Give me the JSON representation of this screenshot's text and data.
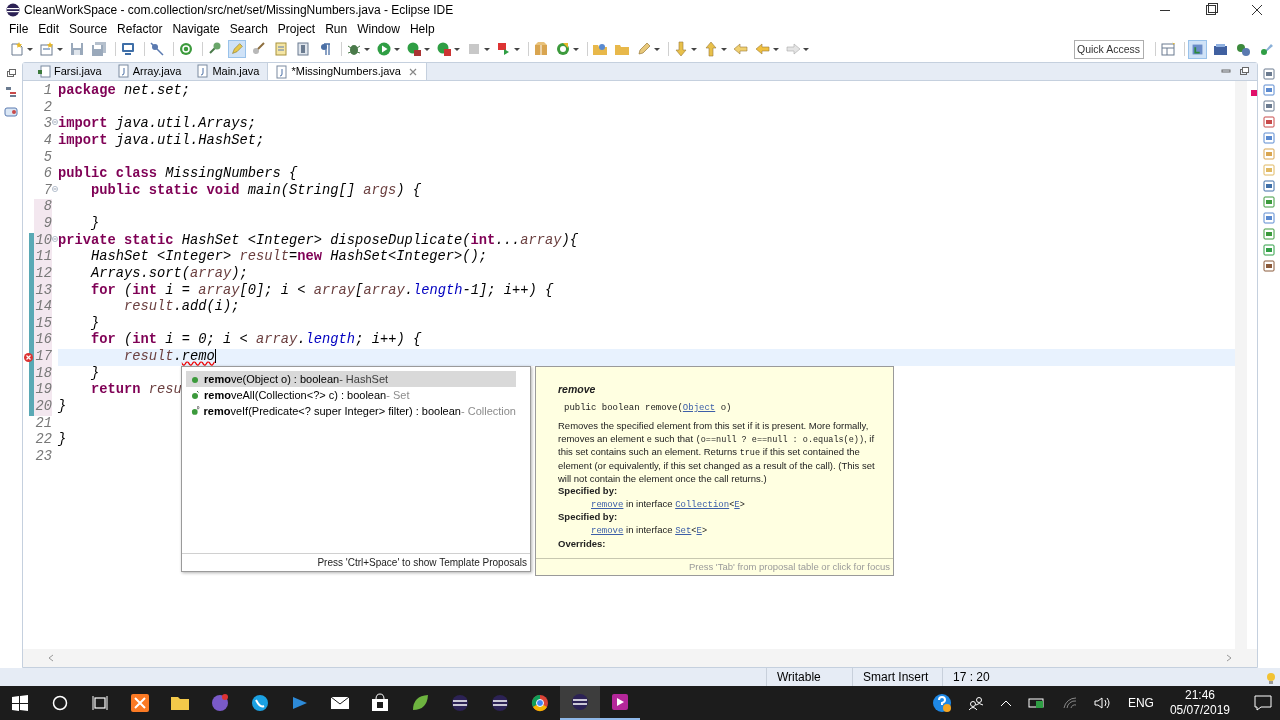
{
  "window": {
    "title": "CleanWorkSpace - com.collection/src/net/set/MissingNumbers.java - Eclipse IDE"
  },
  "menu": [
    "File",
    "Edit",
    "Source",
    "Refactor",
    "Navigate",
    "Search",
    "Project",
    "Run",
    "Window",
    "Help"
  ],
  "toolbar": {
    "mark_occurrences_pressed": true,
    "quick_access": {
      "placeholder": "Quick Access"
    }
  },
  "perspectives": [
    {
      "selected": true
    },
    {
      "selected": false
    },
    {
      "selected": false
    },
    {
      "selected": false
    }
  ],
  "tabs": [
    {
      "label": "Farsi.java",
      "kind": "main",
      "selected": false
    },
    {
      "label": "Array.java",
      "kind": "class",
      "selected": false
    },
    {
      "label": "Main.java",
      "kind": "class",
      "selected": false
    },
    {
      "label": "*MissingNumbers.java",
      "kind": "class",
      "selected": true
    }
  ],
  "editor": {
    "lines": [
      {
        "number": "1",
        "current": false,
        "tokens": [
          {
            "kind": "keyword",
            "text": "package"
          },
          {
            "kind": "text",
            "text": " net.set;"
          }
        ]
      },
      {
        "number": "2",
        "current": false
      },
      {
        "number": "3",
        "current": false,
        "expanded": true,
        "tokens": [
          {
            "kind": "keyword",
            "text": "import"
          },
          {
            "kind": "text",
            "text": " java.util.Arrays;"
          }
        ]
      },
      {
        "number": "4",
        "current": false,
        "tokens": [
          {
            "kind": "keyword",
            "text": "import"
          },
          {
            "kind": "text",
            "text": " java.util.HashSet;"
          }
        ]
      },
      {
        "number": "5",
        "current": false
      },
      {
        "number": "6",
        "current": false,
        "tokens": [
          {
            "kind": "keyword",
            "text": "public class"
          },
          {
            "kind": "text",
            "text": " MissingNumbers {"
          }
        ]
      },
      {
        "number": "7",
        "current": false,
        "expanded": true,
        "tokens": [
          {
            "kind": "keyword",
            "text": "    public static void"
          },
          {
            "kind": "text",
            "text": " main(String[] "
          },
          {
            "kind": "variable",
            "text": "args"
          },
          {
            "kind": "text",
            "text": ") {"
          }
        ]
      },
      {
        "number": "8",
        "current": false,
        "changed": true
      },
      {
        "number": "9",
        "current": false,
        "changed": true,
        "tokens": [
          {
            "kind": "text",
            "text": "    }"
          }
        ]
      },
      {
        "number": "10",
        "current": false,
        "added": true,
        "expanded": true,
        "tokens": [
          {
            "kind": "keyword",
            "text": "private static"
          },
          {
            "kind": "text",
            "text": " HashSet <Integer> disposeDuplicate("
          },
          {
            "kind": "keyword",
            "text": "int"
          },
          {
            "kind": "text",
            "text": "..."
          },
          {
            "kind": "variable",
            "text": "array"
          },
          {
            "kind": "text",
            "text": "){"
          }
        ]
      },
      {
        "number": "11",
        "current": false,
        "added": true,
        "tokens": [
          {
            "kind": "text",
            "text": "    HashSet <Integer> "
          },
          {
            "kind": "variable",
            "text": "result"
          },
          {
            "kind": "text",
            "text": "="
          },
          {
            "kind": "keyword",
            "text": "new"
          },
          {
            "kind": "text",
            "text": " HashSet<Integer>();"
          }
        ]
      },
      {
        "number": "12",
        "current": false,
        "added": true,
        "tokens": [
          {
            "kind": "text",
            "text": "    Arrays.sort("
          },
          {
            "kind": "variable",
            "text": "array"
          },
          {
            "kind": "text",
            "text": ");"
          }
        ]
      },
      {
        "number": "13",
        "current": false,
        "added": true,
        "tokens": [
          {
            "kind": "keyword",
            "text": "    for"
          },
          {
            "kind": "text",
            "text": " ("
          },
          {
            "kind": "keyword",
            "text": "int"
          },
          {
            "kind": "text",
            "text": " i = "
          },
          {
            "kind": "variable",
            "text": "array"
          },
          {
            "kind": "text",
            "text": "[0]; i < "
          },
          {
            "kind": "variable",
            "text": "array"
          },
          {
            "kind": "text",
            "text": "["
          },
          {
            "kind": "variable",
            "text": "array"
          },
          {
            "kind": "text",
            "text": "."
          },
          {
            "kind": "field",
            "text": "length"
          },
          {
            "kind": "text",
            "text": "-1]; i++) {"
          }
        ]
      },
      {
        "number": "14",
        "current": false,
        "added": true,
        "tokens": [
          {
            "kind": "variable",
            "text": "        result"
          },
          {
            "kind": "text",
            "text": ".add(i);"
          }
        ]
      },
      {
        "number": "15",
        "current": false,
        "added": true,
        "tokens": [
          {
            "kind": "text",
            "text": "    }"
          }
        ]
      },
      {
        "number": "16",
        "current": false,
        "added": true,
        "tokens": [
          {
            "kind": "keyword",
            "text": "    for"
          },
          {
            "kind": "text",
            "text": " ("
          },
          {
            "kind": "keyword",
            "text": "int"
          },
          {
            "kind": "text",
            "text": " i = 0; i < "
          },
          {
            "kind": "variable",
            "text": "array"
          },
          {
            "kind": "text",
            "text": "."
          },
          {
            "kind": "field",
            "text": "length"
          },
          {
            "kind": "text",
            "text": "; i++) {"
          }
        ]
      },
      {
        "number": "17",
        "current": true,
        "added": true,
        "error": true,
        "tokens": [
          {
            "kind": "variable",
            "text": "        result"
          },
          {
            "kind": "text",
            "text": "."
          },
          {
            "kind": "error",
            "text": "remo"
          }
        ]
      },
      {
        "number": "18",
        "current": false,
        "added": true,
        "tokens": [
          {
            "kind": "text",
            "text": "    }"
          }
        ]
      },
      {
        "number": "19",
        "current": false,
        "added": true,
        "tokens": [
          {
            "kind": "keyword",
            "text": "    return"
          },
          {
            "kind": "variable",
            "text": " resu"
          }
        ]
      },
      {
        "number": "20",
        "current": false,
        "added": true,
        "tokens": [
          {
            "kind": "text",
            "text": "}"
          }
        ]
      },
      {
        "number": "21",
        "current": false
      },
      {
        "number": "22",
        "current": false,
        "tokens": [
          {
            "kind": "text",
            "text": "}"
          }
        ]
      },
      {
        "number": "23",
        "current": false
      }
    ]
  },
  "proposals": {
    "items": [
      {
        "label": "**remo**ve(Object o) : boolean",
        "owner": " - HashSet",
        "kind": "method",
        "selected": true
      },
      {
        "label": "**remo**veAll(Collection<?> c) : boolean",
        "owner": " - Set",
        "kind": "abstract",
        "selected": false
      },
      {
        "label": "**remo**veIf(Predicate<? super Integer> filter) : boolean",
        "owner": " - Collection",
        "kind": "default",
        "selected": false
      }
    ],
    "footer": "Press 'Ctrl+Space' to show Template Proposals"
  },
  "javadoc": {
    "title": "remove",
    "signature": [
      {
        "kind": "code",
        "text": "public boolean remove("
      },
      {
        "kind": "link",
        "text": "Object"
      },
      {
        "kind": "code",
        "text": " o)"
      }
    ],
    "description": [
      {
        "kind": "text",
        "text": "Removes the specified element from this set if it is present. More formally, removes an element "
      },
      {
        "kind": "code",
        "text": "e"
      },
      {
        "kind": "text",
        "text": " such that "
      },
      {
        "kind": "code",
        "text": "(o==null ? e==null : o.equals(e))"
      },
      {
        "kind": "text",
        "text": ", if this set contains such an element. Returns "
      },
      {
        "kind": "code",
        "text": "true"
      },
      {
        "kind": "text",
        "text": " if this set contained the element (or equivalently, if this set changed as a result of the call). (This set will not contain the element once the call returns.)"
      }
    ],
    "sections": [
      {
        "heading": "Specified by:",
        "entry": [
          {
            "kind": "link",
            "text": "remove"
          },
          {
            "kind": "text",
            "text": " in interface "
          },
          {
            "kind": "link",
            "text": "Collection"
          },
          {
            "kind": "code",
            "text": "<"
          },
          {
            "kind": "link",
            "text": "E"
          },
          {
            "kind": "code",
            "text": ">"
          }
        ]
      },
      {
        "heading": "Specified by:",
        "entry": [
          {
            "kind": "link",
            "text": "remove"
          },
          {
            "kind": "text",
            "text": " in interface "
          },
          {
            "kind": "link",
            "text": "Set"
          },
          {
            "kind": "code",
            "text": "<"
          },
          {
            "kind": "link",
            "text": "E"
          },
          {
            "kind": "code",
            "text": ">"
          }
        ]
      },
      {
        "heading": "Overrides:"
      }
    ],
    "footer": "Press 'Tab' from proposal table or click for focus"
  },
  "status_bar": [
    "Writable",
    "Smart Insert",
    "17 : 20"
  ],
  "taskbar": {
    "apps": [
      {
        "active": false,
        "running": false
      },
      {
        "active": false,
        "running": false
      },
      {
        "active": false,
        "running": false
      },
      {
        "active": false,
        "running": false
      },
      {
        "active": false,
        "running": false
      },
      {
        "active": false,
        "running": false
      },
      {
        "active": false,
        "running": false
      },
      {
        "active": false,
        "running": false
      },
      {
        "active": false,
        "running": false
      },
      {
        "active": false,
        "running": false
      },
      {
        "active": false,
        "running": false
      },
      {
        "active": true,
        "running": true
      },
      {
        "active": false,
        "running": true
      }
    ],
    "language": "ENG",
    "time": "21:46",
    "date": "05/07/2019"
  }
}
